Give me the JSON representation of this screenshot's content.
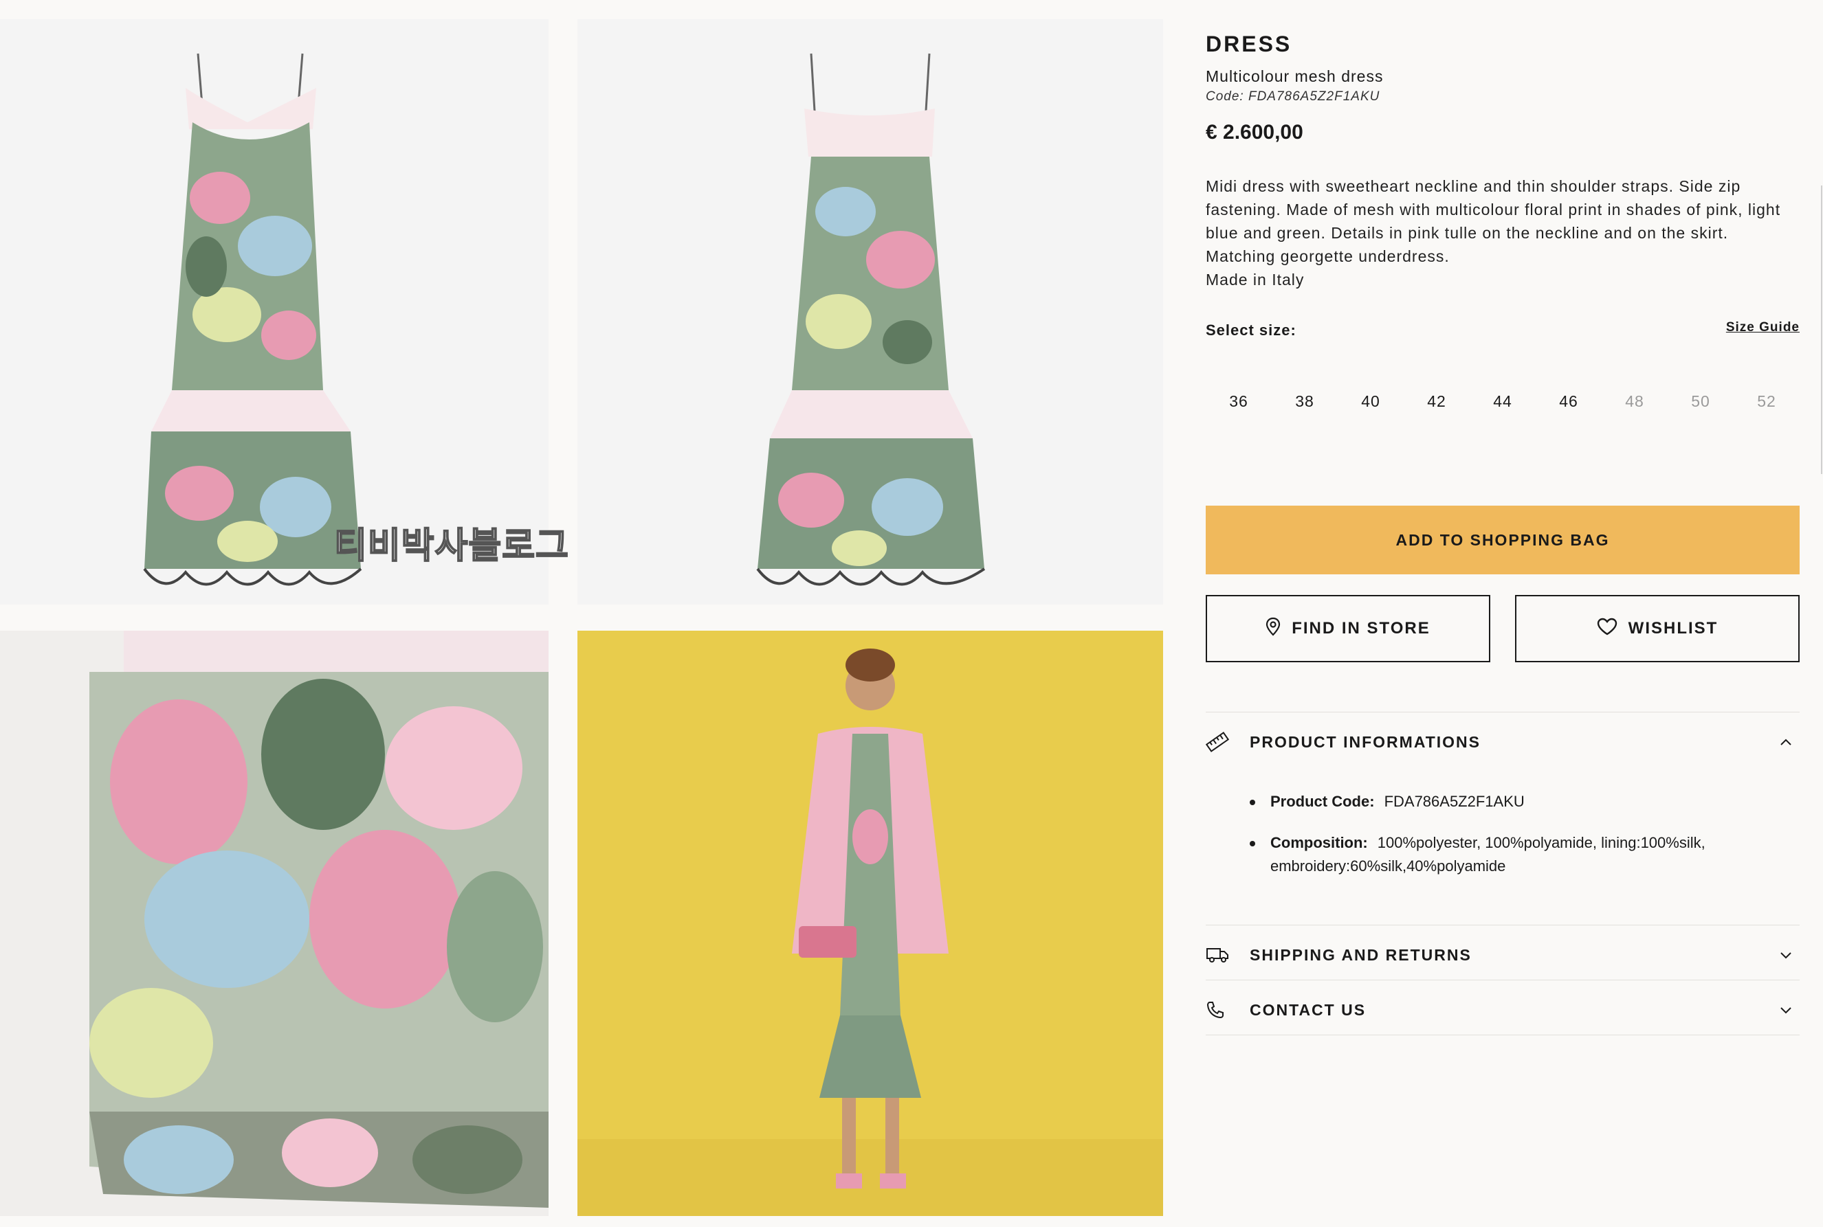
{
  "product": {
    "title": "DRESS",
    "subtitle": "Multicolour mesh dress",
    "code_line": "Code: FDA786A5Z2F1AKU",
    "price": "€ 2.600,00",
    "description": [
      "Midi dress with sweetheart neckline and thin shoulder straps. Side zip fastening. Made of mesh with multicolour floral print in shades of pink, light blue and green. Details in pink tulle on the neckline and on the skirt. Matching georgette underdress.",
      "Made in Italy"
    ]
  },
  "size_selector": {
    "label": "Select size:",
    "guide": "Size Guide",
    "sizes": [
      {
        "label": "36",
        "available": true
      },
      {
        "label": "38",
        "available": true
      },
      {
        "label": "40",
        "available": true
      },
      {
        "label": "42",
        "available": true
      },
      {
        "label": "44",
        "available": true
      },
      {
        "label": "46",
        "available": true
      },
      {
        "label": "48",
        "available": false
      },
      {
        "label": "50",
        "available": false
      },
      {
        "label": "52",
        "available": false
      }
    ]
  },
  "actions": {
    "add_to_bag": "ADD TO SHOPPING BAG",
    "find_in_store": "FIND IN STORE",
    "wishlist": "WISHLIST"
  },
  "accordions": [
    {
      "label": "PRODUCT INFORMATIONS",
      "icon": "ruler-icon",
      "expanded": true
    },
    {
      "label": "SHIPPING AND RETURNS",
      "icon": "truck-icon",
      "expanded": false
    },
    {
      "label": "CONTACT US",
      "icon": "phone-icon",
      "expanded": false
    }
  ],
  "product_info": {
    "code_label": "Product Code:",
    "code_value": "FDA786A5Z2F1AKU",
    "composition_label": "Composition:",
    "composition_value": "100%polyester, 100%polyamide, lining:100%silk, embroidery:60%silk,40%polyamide"
  },
  "gallery": {
    "watermark": "티비박사블로그"
  },
  "colors": {
    "accent_button": "#f0b95c",
    "model_background": "#e8cc4c",
    "unavailable_size": "#9a9a9a"
  }
}
